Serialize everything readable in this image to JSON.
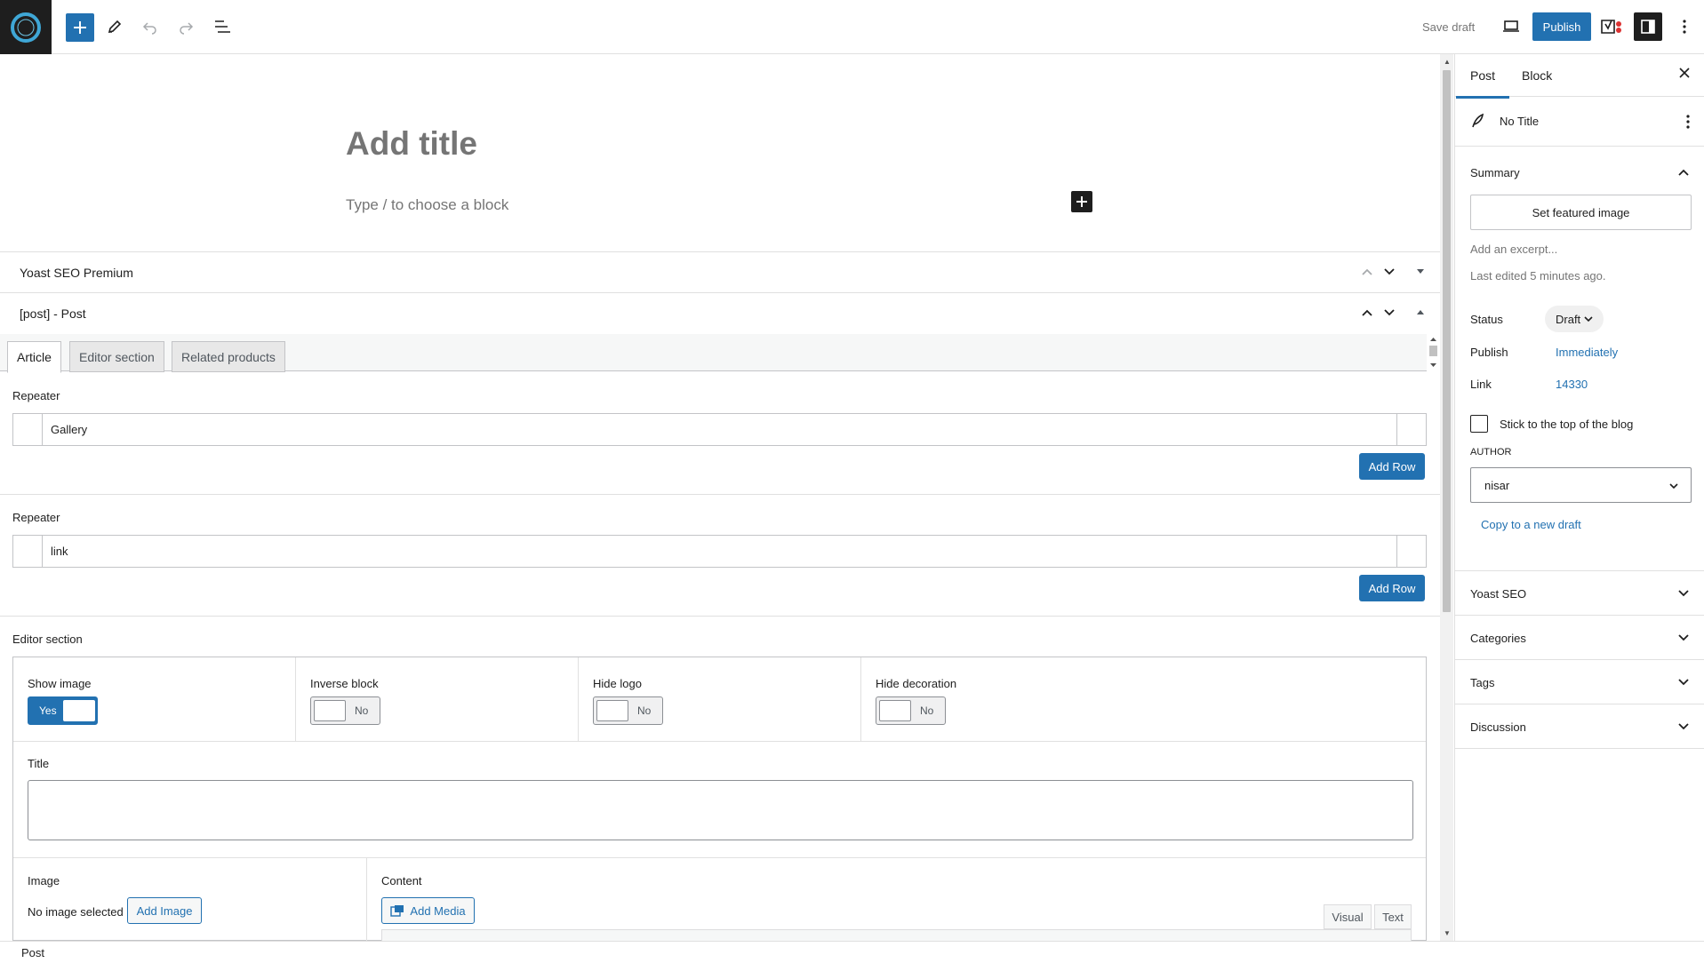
{
  "topbar": {
    "save_draft": "Save draft",
    "publish": "Publish",
    "yoast_badge": "Y!"
  },
  "editor": {
    "title_placeholder": "Add title",
    "block_placeholder": "Type / to choose a block"
  },
  "metaboxes": {
    "yoast_title": "Yoast SEO Premium",
    "post_title": "[post] - Post"
  },
  "acf": {
    "tabs": [
      "Article",
      "Editor section",
      "Related products"
    ],
    "repeaters": [
      {
        "label": "Repeater",
        "row": "Gallery",
        "add_row": "Add Row"
      },
      {
        "label": "Repeater",
        "row": "link",
        "add_row": "Add Row"
      }
    ],
    "editor_section": {
      "label": "Editor section",
      "toggles": [
        {
          "label": "Show image",
          "state": "Yes",
          "on": true
        },
        {
          "label": "Inverse block",
          "state": "No",
          "on": false
        },
        {
          "label": "Hide logo",
          "state": "No",
          "on": false
        },
        {
          "label": "Hide decoration",
          "state": "No",
          "on": false
        }
      ],
      "title_label": "Title",
      "title_value": "",
      "image_label": "Image",
      "no_image": "No image selected",
      "add_image": "Add Image",
      "content_label": "Content",
      "add_media": "Add Media",
      "visual_tab": "Visual",
      "text_tab": "Text"
    }
  },
  "footer": {
    "breadcrumb": "Post"
  },
  "sidebar": {
    "tabs": [
      "Post",
      "Block"
    ],
    "post_title": "No Title",
    "summary_title": "Summary",
    "featured_image": "Set featured image",
    "excerpt": "Add an excerpt...",
    "last_edited": "Last edited 5 minutes ago.",
    "status_label": "Status",
    "status_value": "Draft",
    "publish_label": "Publish",
    "publish_value": "Immediately",
    "link_label": "Link",
    "link_value": "14330",
    "sticky_label": "Stick to the top of the blog",
    "author_label": "AUTHOR",
    "author_value": "nisar",
    "copy_draft": "Copy to a new draft",
    "panels": [
      "Yoast SEO",
      "Categories",
      "Tags",
      "Discussion"
    ]
  },
  "colors": {
    "accent": "#2271b1",
    "dark": "#1e1e1e",
    "muted": "#757575"
  }
}
